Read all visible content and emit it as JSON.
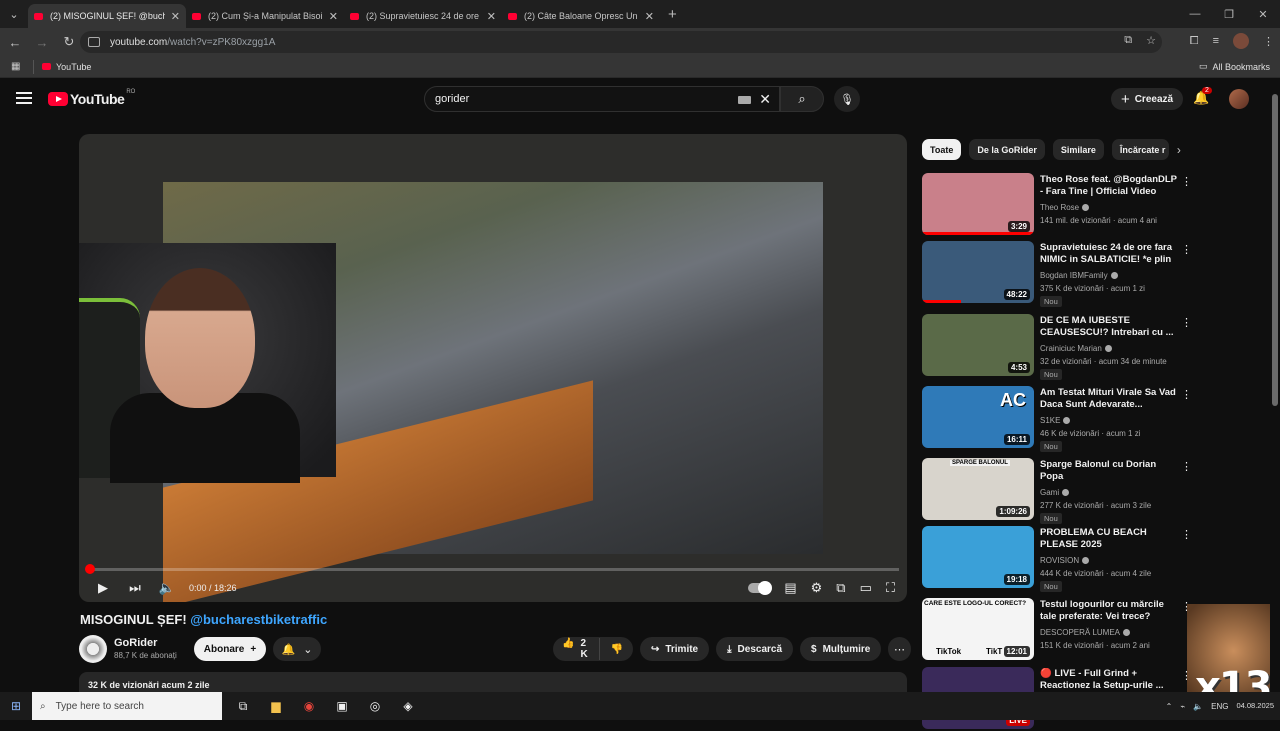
{
  "browser": {
    "tabs": [
      {
        "title": "(2) MISOGINUL ȘEF! @buchare",
        "active": true
      },
      {
        "title": "(2) Cum Și-a Manipulat Bisoi Co",
        "active": false
      },
      {
        "title": "(2) Supravietuiesc 24 de ore fa",
        "active": false
      },
      {
        "title": "(2) Câte Baloane Opresc Un Fie",
        "active": false
      }
    ],
    "url_host": "youtube.com",
    "url_path": "/watch?v=zPK80xzgg1A",
    "bookmark_youtube": "YouTube",
    "all_bookmarks": "All Bookmarks"
  },
  "youtube": {
    "logo_text": "YouTube",
    "region": "RO",
    "search_query": "gorider",
    "create_label": "Creează",
    "notification_count": "2"
  },
  "player": {
    "current_time": "0:00",
    "duration": "18:26",
    "time_display": "0:00 / 18:26",
    "progress_fraction": 0.004
  },
  "video": {
    "title": "MISOGINUL ȘEF!",
    "title_tag": "@bucharestbiketraffic",
    "channel": "GoRider",
    "subscribers": "88,7 K de abonați",
    "subscribe_label": "Abonare",
    "likes": "2 K",
    "share_label": "Trimite",
    "download_label": "Descarcă",
    "thanks_label": "Mulțumire",
    "views_date": "32 K de vizionări  acum 2 zile"
  },
  "chips": [
    "Toate",
    "De la GoRider",
    "Similare",
    "Încărcate r"
  ],
  "recommendations": [
    {
      "title": "Theo Rose feat. @BogdanDLP - Fara Tine | Official Video",
      "channel": "Theo Rose",
      "meta": "141 mil. de vizionări · acum 4 ani",
      "duration": "3:29",
      "badge": "",
      "thumb": "#c9808a"
    },
    {
      "title": "Supravietuiesc 24 de ore fara NIMIC in SALBATICIE! *e plin ...",
      "channel": "Bogdan IBMFamily",
      "meta": "375 K de vizionări · acum 1 zi",
      "duration": "48:22",
      "badge": "Nou",
      "thumb": "#3a5a7a"
    },
    {
      "title": "DE CE MA IUBESTE CEAUSESCU!? Intrebari cu ...",
      "channel": "Crainiciuc Marian",
      "meta": "32 de vizionări · acum 34 de minute",
      "duration": "4:53",
      "badge": "Nou",
      "thumb": "#5a6a48"
    },
    {
      "title": "Am Testat Mituri Virale Sa Vad Daca Sunt Adevarate...",
      "channel": "S1KE",
      "meta": "46 K de vizionări · acum 1 zi",
      "duration": "16:11",
      "badge": "Nou",
      "thumb": "#2f7ab8"
    },
    {
      "title": "Sparge Balonul cu Dorian Popa",
      "channel": "Gami",
      "meta": "277 K de vizionări · acum 3 zile",
      "duration": "1:09:26",
      "badge": "Nou",
      "thumb": "#d8d4cc"
    },
    {
      "title": "PROBLEMA CU BEACH PLEASE 2025",
      "channel": "ROVISION",
      "meta": "444 K de vizionări · acum 4 zile",
      "duration": "19:18",
      "badge": "Nou",
      "thumb": "#3aa0d8"
    },
    {
      "title": "Testul logourilor cu mărcile tale preferate: Vei trece?",
      "channel": "DESCOPERĂ LUMEA",
      "meta": "151 K de vizionări · acum 2 ani",
      "duration": "12:01",
      "badge": "",
      "thumb": "#f4f4f4"
    },
    {
      "title": "🔴 LIVE - Full Grind + Reactionez la Setup-urile ...",
      "channel": "",
      "meta": "",
      "duration": "LIVE",
      "badge": "",
      "thumb": "#3a2a5a"
    }
  ],
  "thumb_texts": {
    "rec3": "AC",
    "rec4": "SPARGE BALONUL",
    "rec6_top": "CARE ESTE LOGO-UL CORECT?",
    "rec6_a": "TikTok",
    "rec6_b": "TikT"
  },
  "overlay": {
    "multiplier": "x13"
  },
  "taskbar": {
    "search_placeholder": "Type here to search",
    "lang": "ENG",
    "date": "04.08.2025"
  },
  "colors": {
    "accent": "#ff0033",
    "link": "#3ea6ff",
    "background": "#0f0f0f"
  }
}
